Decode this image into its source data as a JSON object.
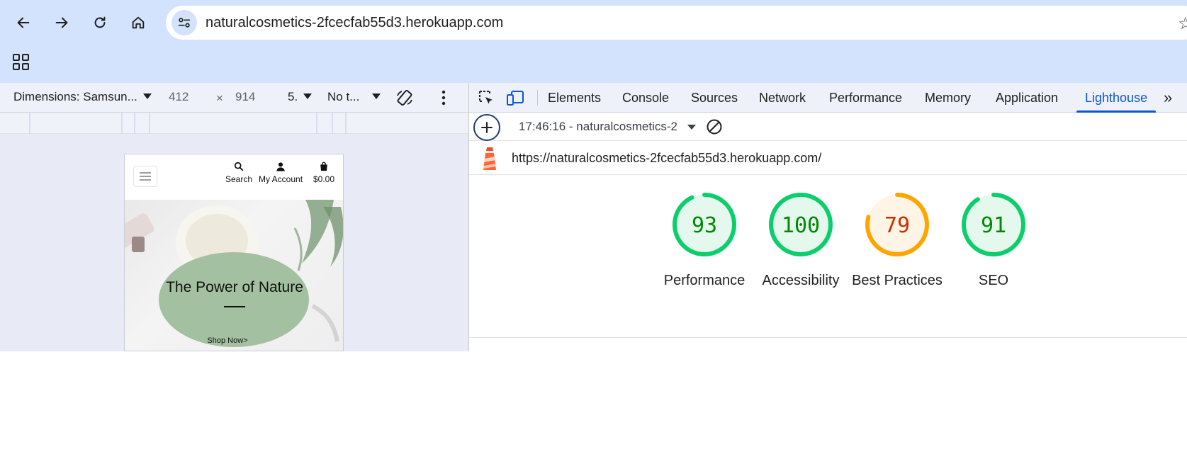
{
  "browser": {
    "url": "naturalcosmetics-2fcecfab55d3.herokuapp.com",
    "buttons": {
      "back": "back-arrow-icon",
      "forward": "forward-arrow-icon",
      "reload": "reload-icon",
      "home": "home-icon"
    }
  },
  "device_toolbar": {
    "dimensions_label": "Dimensions: Samsun...",
    "width": "412",
    "times": "×",
    "height": "914",
    "zoom": "5.",
    "throttle": "No t..."
  },
  "phone_page": {
    "nav": {
      "search": "Search",
      "account": "My Account",
      "cart": "$0.00"
    },
    "hero_title": "The Power of Nature",
    "hero_cta": "Shop Now>"
  },
  "devtools": {
    "tabs": [
      "Elements",
      "Console",
      "Sources",
      "Network",
      "Performance",
      "Memory",
      "Application",
      "Lighthouse"
    ],
    "active_tab": "Lighthouse",
    "more": "»"
  },
  "lighthouse": {
    "report_select": "17:46:16 - naturalcosmetics-2",
    "url": "https://naturalcosmetics-2fcecfab55d3.herokuapp.com/",
    "scores": [
      {
        "label": "Performance",
        "score": "93",
        "value": 93,
        "status": "pass"
      },
      {
        "label": "Accessibility",
        "score": "100",
        "value": 100,
        "status": "pass"
      },
      {
        "label": "Best Practices",
        "score": "79",
        "value": 79,
        "status": "average"
      },
      {
        "label": "SEO",
        "score": "91",
        "value": 91,
        "status": "pass"
      }
    ],
    "colors": {
      "pass_ring": "#0cce6b",
      "pass_fill": "#e5f8ee",
      "pass_text": "#008800",
      "average_ring": "#ffa400",
      "average_fill": "#fff5e6",
      "average_text": "#c33300"
    }
  }
}
